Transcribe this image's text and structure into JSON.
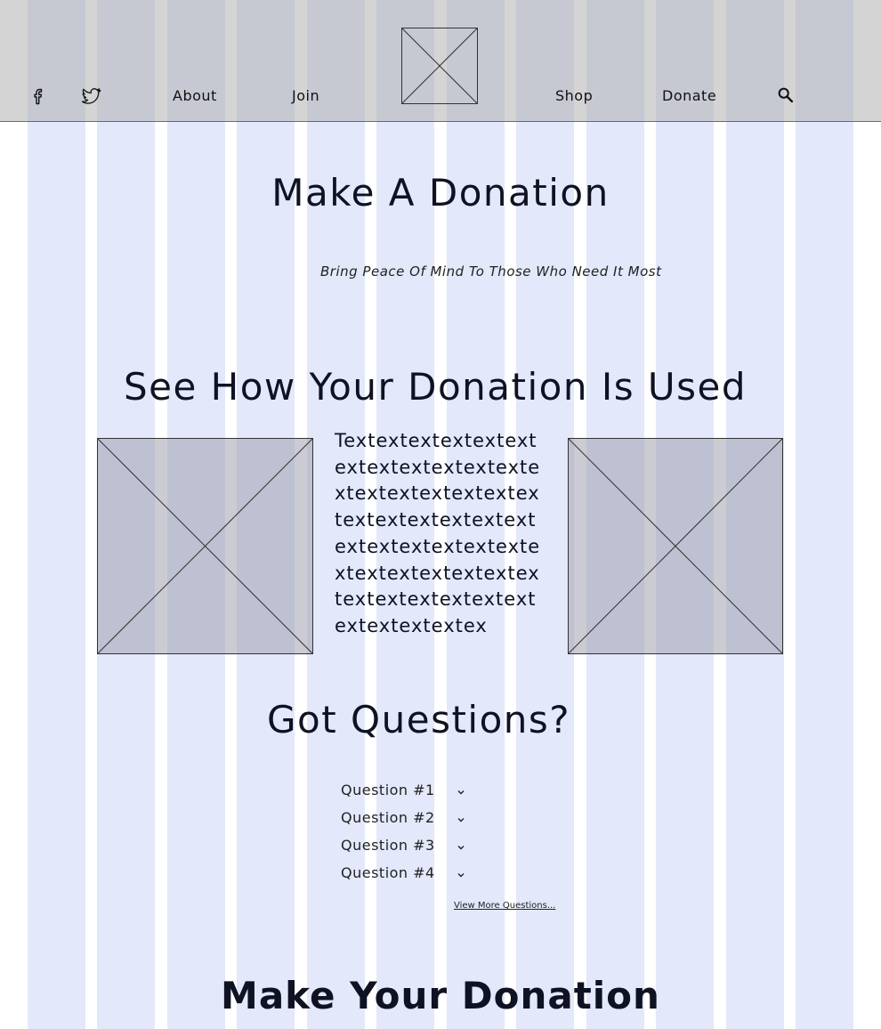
{
  "header": {
    "nav": {
      "about": "About",
      "join": "Join",
      "shop": "Shop",
      "donate": "Donate"
    },
    "icons": {
      "facebook": "facebook-icon",
      "twitter": "twitter-icon",
      "search": "search-icon",
      "logo": "logo-placeholder"
    }
  },
  "hero": {
    "title": "Make A Donation",
    "subtitle": "Bring Peace Of Mind To Those Who Need It Most"
  },
  "usage": {
    "title": "See How Your Donation Is Used",
    "body": "Textextextextextextextextextextextextextextextextextextextextextextextextextextextextextextextextextextextextextextextextextextextextextextextextex"
  },
  "faq": {
    "title": "Got Questions?",
    "questions": [
      "Question #1",
      "Question #2",
      "Question #3",
      "Question #4"
    ],
    "more_link": "View More Questions..."
  },
  "donate_section": {
    "title": "Make Your Donation"
  },
  "colors": {
    "grid_column": "#e3e8fb",
    "header_bg": "#aaaaaa",
    "text": "#0f1222"
  }
}
